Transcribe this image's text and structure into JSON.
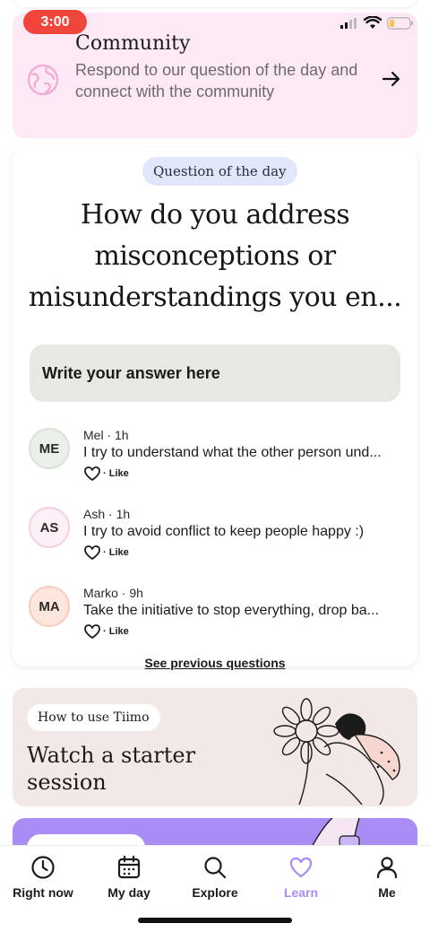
{
  "status": {
    "time": "3:00"
  },
  "community": {
    "title": "Community",
    "description": "Respond to our question of the day and connect with the community"
  },
  "question_card": {
    "badge": "Question of the day",
    "question": "How do you address misconceptions or misunderstandings you en...",
    "answer_placeholder": "Write your answer here",
    "answers": [
      {
        "initials": "ME",
        "meta": "Mel · 1h",
        "text": "I try to understand what the other person und...",
        "like": "· Like",
        "avatar_bg": "#eaf1ea",
        "avatar_border": "#d6e3d6"
      },
      {
        "initials": "AS",
        "meta": "Ash · 1h",
        "text": "I try to avoid conflict to keep people happy :)",
        "like": "· Like",
        "avatar_bg": "#fff0f8",
        "avatar_border": "#f6cfe6"
      },
      {
        "initials": "MA",
        "meta": "Marko · 9h",
        "text": "Take the initiative to stop everything, drop ba...",
        "like": "· Like",
        "avatar_bg": "#fde6dc",
        "avatar_border": "#f8cdbb"
      }
    ],
    "see_previous": "See previous questions"
  },
  "tiimo_card": {
    "badge": "How to use Tiimo",
    "title": "Watch a starter session"
  },
  "tabbar": {
    "items": [
      {
        "label": "Right now",
        "icon": "clock-icon"
      },
      {
        "label": "My day",
        "icon": "calendar-icon"
      },
      {
        "label": "Explore",
        "icon": "search-icon"
      },
      {
        "label": "Learn",
        "icon": "heart-icon",
        "active": true
      },
      {
        "label": "Me",
        "icon": "person-icon"
      }
    ]
  },
  "colors": {
    "status_pill": "#f0453a",
    "community_bg": "#fde9f6",
    "badge_bg": "#e2e6fb",
    "answer_box_bg": "#e9e7e1",
    "tiimo_bg": "#f2e8e5",
    "purple_card_bg": "#a98cf4",
    "active_tab": "#a98cf4"
  }
}
